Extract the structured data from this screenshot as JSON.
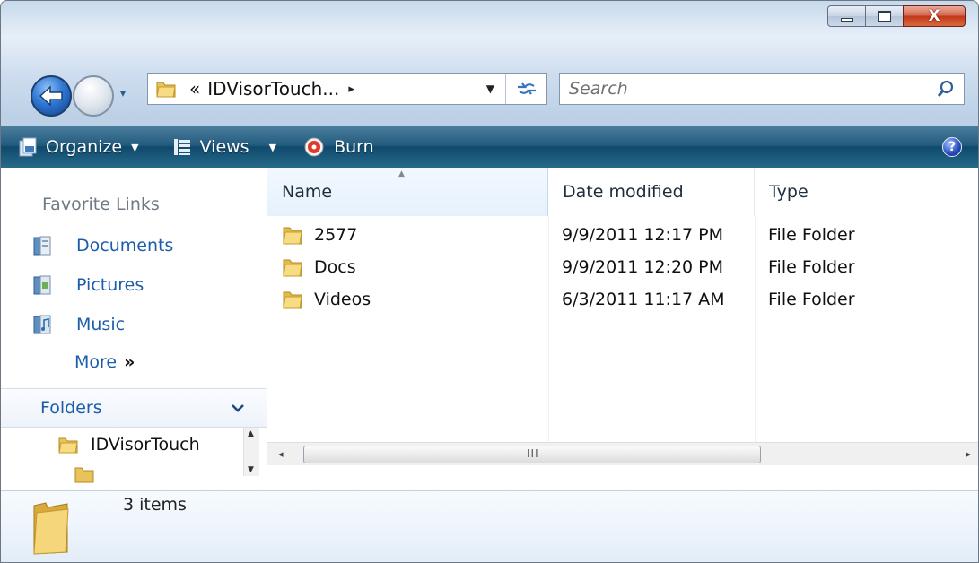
{
  "window": {
    "caption_buttons": {
      "minimize": "",
      "maximize": "",
      "close": "X"
    },
    "colors": {
      "toolbar": "#1f5a7c",
      "link": "#1c5daa",
      "close": "#c2371a"
    }
  },
  "address_bar": {
    "prefix": "«",
    "path": "IDVisorTouch...",
    "chevron": "▸",
    "dropdown": "▼",
    "refresh_icon": "refresh-icon"
  },
  "search": {
    "placeholder": "Search",
    "icon": "search-icon"
  },
  "nav_buttons": {
    "dropdown": "▾"
  },
  "toolbar": {
    "organize_label": "Organize",
    "views_label": "Views",
    "burn_label": "Burn",
    "arrow": "▼",
    "help_label": "?"
  },
  "nav_pane": {
    "favorite_links_heading": "Favorite Links",
    "links": [
      {
        "label": "Documents",
        "icon": "documents-icon"
      },
      {
        "label": "Pictures",
        "icon": "pictures-icon"
      },
      {
        "label": "Music",
        "icon": "music-icon"
      }
    ],
    "more_label": "More",
    "more_arrows": "»",
    "folders_label": "Folders",
    "folders_chevron": "⌄",
    "tree": [
      {
        "label": "IDVisorTouch"
      }
    ]
  },
  "file_list": {
    "columns": [
      "Name",
      "Date modified",
      "Type"
    ],
    "sort_arrow": "▲",
    "rows": [
      {
        "name": "2577",
        "date": "9/9/2011 12:17 PM",
        "type": "File Folder"
      },
      {
        "name": "Docs",
        "date": "9/9/2011 12:20 PM",
        "type": "File Folder"
      },
      {
        "name": "Videos",
        "date": "6/3/2011 11:17 AM",
        "type": "File Folder"
      }
    ],
    "scroll": {
      "left": "◂",
      "right": "▸",
      "grip": "III"
    }
  },
  "details_pane": {
    "item_count": "3 items"
  }
}
